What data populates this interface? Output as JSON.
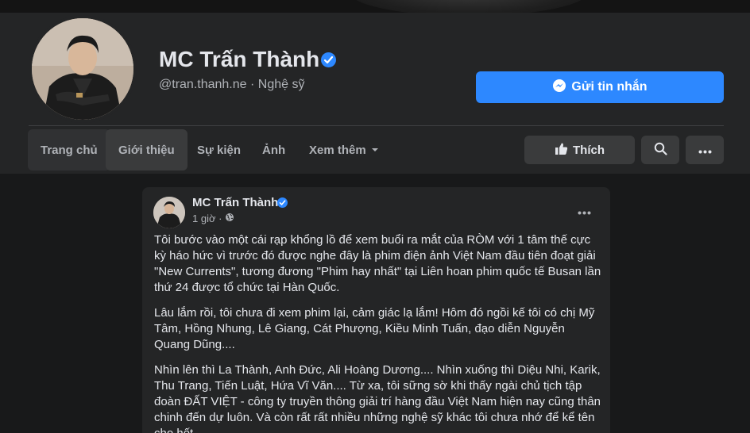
{
  "profile": {
    "name": "MC Trấn Thành",
    "handle": "@tran.thanh.ne · Nghệ sỹ",
    "message_button": "Gửi tin nhắn"
  },
  "tabs": [
    {
      "label": "Trang chủ"
    },
    {
      "label": "Giới thiệu"
    },
    {
      "label": "Sự kiện"
    },
    {
      "label": "Ảnh"
    },
    {
      "label": "Xem thêm"
    }
  ],
  "actions": {
    "like_label": "Thích"
  },
  "post": {
    "author": "MC Trấn Thành",
    "time": "1 giờ ·",
    "paragraphs": [
      "Tôi bước vào một cái rạp khổng lồ để xem buổi ra mắt của RÒM với 1 tâm thế cực kỳ háo hức vì trước đó được nghe đây là phim điện ảnh Việt Nam đầu tiên đoạt giải \"New Currents\", tương đương \"Phim hay nhất\" tại Liên hoan phim quốc tế Busan lần thứ 24 được tổ chức tại Hàn Quốc.",
      "Lâu lắm rồi, tôi chưa đi xem phim lại, cảm giác lạ lắm! Hôm đó ngồi kế tôi có chị Mỹ Tâm, Hồng Nhung, Lê Giang, Cát Phượng, Kiều Minh Tuấn, đạo diễn Nguyễn Quang Dũng....",
      "Nhìn lên thì La Thành, Anh Đức, Ali Hoàng Dương.... Nhìn xuống thì Diệu Nhi, Karik, Thu Trang, Tiến Luật, Hứa Vĩ Văn.... Từ xa, tôi sững sờ khi thấy ngài chủ tịch tập đoàn ĐẤT VIỆT - công ty truyền thông giải trí hàng đầu Việt Nam hiện nay cũng thân chinh đến dự luôn. Và còn rất rất nhiều những nghệ sỹ khác tôi chưa nhớ để kể tên cho hết."
    ]
  },
  "colors": {
    "page_bg": "#18191a",
    "surface": "#242526",
    "accent": "#2d88ff",
    "text_primary": "#e4e6eb",
    "text_secondary": "#b0b3b8"
  },
  "icons": {
    "verified": "verified-badge-icon",
    "messenger": "messenger-icon",
    "like": "thumbs-up-icon",
    "search": "search-icon",
    "more": "more-dots-icon",
    "globe": "globe-icon",
    "caret": "caret-down-icon"
  }
}
